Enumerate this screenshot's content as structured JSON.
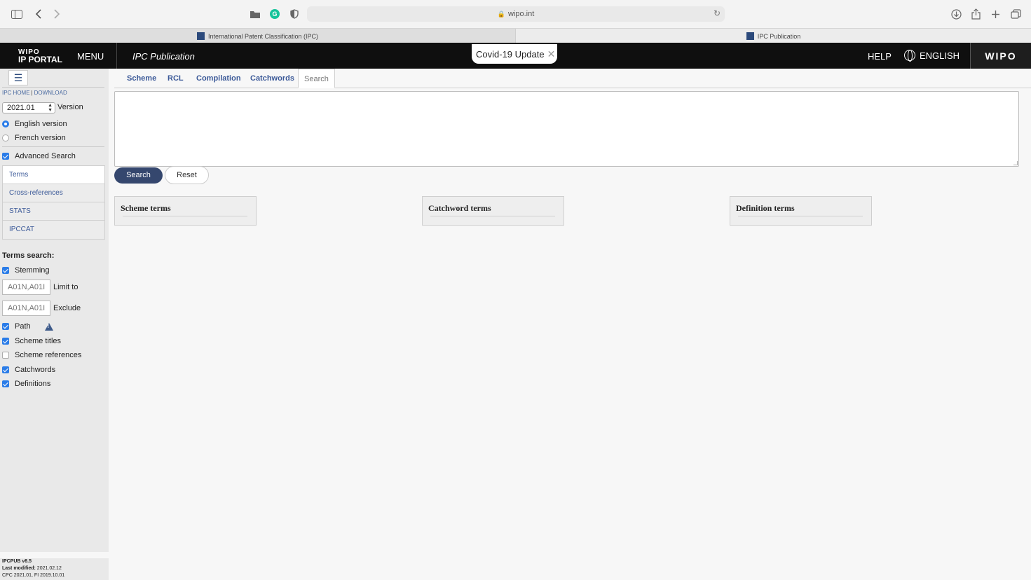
{
  "browser": {
    "url": "wipo.int",
    "tabs": [
      "International Patent Classification (IPC)",
      "IPC Publication"
    ]
  },
  "header": {
    "logo_line1": "WIPO",
    "logo_line2": "IP PORTAL",
    "menu": "MENU",
    "title": "IPC Publication",
    "covid": "Covid-19 Update",
    "help": "HELP",
    "language": "ENGLISH",
    "brand": "WIPO"
  },
  "sidebar": {
    "links": [
      "IPC HOME",
      "DOWNLOAD"
    ],
    "version_value": "2021.01",
    "version_label": "Version",
    "lang_options": [
      "English version",
      "French version"
    ],
    "advanced_search": "Advanced Search",
    "nav": [
      "Terms",
      "Cross-references",
      "STATS",
      "IPCCAT"
    ],
    "terms_search_title": "Terms search:",
    "stemming": "Stemming",
    "limit_placeholder": "A01N,A01I",
    "limit_label": "Limit to",
    "exclude_placeholder": "A01N,A01I",
    "exclude_label": "Exclude",
    "path": "Path",
    "options": [
      "Scheme titles",
      "Scheme references",
      "Catchwords",
      "Definitions"
    ],
    "footer_line1": "IPCPUB v8.5",
    "footer_line2_label": "Last modified:",
    "footer_line2_value": "2021.02.12",
    "footer_line3": "CPC 2021.01, FI 2019.10.01"
  },
  "main": {
    "tabs": [
      "Scheme",
      "RCL",
      "Compilation",
      "Catchwords",
      "Search"
    ],
    "search_button": "Search",
    "reset_button": "Reset",
    "panels": [
      "Scheme terms",
      "Catchword terms",
      "Definition terms"
    ]
  }
}
